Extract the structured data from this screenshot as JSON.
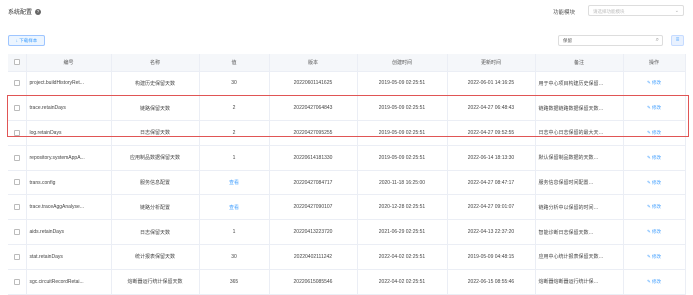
{
  "header": {
    "title": "系统配置",
    "help_icon": "?",
    "module_label": "功能模块",
    "module_placeholder": "请选择功能模块"
  },
  "toolbar": {
    "download_label": "↓ 下载样本",
    "search_value": "保留",
    "columns_icon": "≡"
  },
  "table": {
    "columns": [
      "",
      "编号",
      "名称",
      "值",
      "版本",
      "创建时间",
      "更新时间",
      "备注",
      "操作"
    ],
    "rows": [
      {
        "code": "project.buildHistoryRet...",
        "name": "构建历史保留天数",
        "value": "30",
        "version": "20220601141625",
        "created": "2019-05-09 02:25:51",
        "updated": "2022-06-01 14:16:25",
        "remark": "用于中心项目构建历史保留…",
        "action": "✎ 修改"
      },
      {
        "code": "trace.retainDays",
        "name": "链路保留天数",
        "value": "2",
        "version": "20220427064843",
        "created": "2019-05-09 02:25:51",
        "updated": "2022-04-27 06:48:43",
        "remark": "链路数据链路数据保留天数…",
        "action": "✎ 修改"
      },
      {
        "code": "log.retainDays",
        "name": "日志保留天数",
        "value": "2",
        "version": "20220427095255",
        "created": "2019-05-09 02:25:51",
        "updated": "2022-04-27 09:52:55",
        "remark": "日志中心日志保留的最大天…",
        "action": "✎ 修改"
      },
      {
        "code": "repository.systemAppA...",
        "name": "应用制品数据保留天数",
        "value": "1",
        "version": "20220614181330",
        "created": "2019-05-09 02:25:51",
        "updated": "2022-06-14 18:13:30",
        "remark": "默认保留制品数据的天数…",
        "action": "✎ 修改"
      },
      {
        "code": "trans.config",
        "name": "服务信息配置",
        "value": "查看",
        "version": "20220427084717",
        "created": "2020-11-18 16:25:00",
        "updated": "2022-04-27 08:47:17",
        "remark": "服务信息保留时间配置…",
        "action": "✎ 修改"
      },
      {
        "code": "trace.traceAggAnalyse...",
        "name": "链路分析配置",
        "value": "查看",
        "version": "20220427090107",
        "created": "2020-12-28 02:25:51",
        "updated": "2022-04-27 09:01:07",
        "remark": "链路分析中以保留的时间…",
        "action": "✎ 修改"
      },
      {
        "code": "aids.retainDays",
        "name": "日志保留天数",
        "value": "1",
        "version": "20220413223720",
        "created": "2021-06-29 02:25:51",
        "updated": "2022-04-13 22:37:20",
        "remark": "智能诊断日志保留天数…",
        "action": "✎ 修改"
      },
      {
        "code": "stat.retainDays",
        "name": "统计报表保留天数",
        "value": "30",
        "version": "20220402111242",
        "created": "2022-04-02 02:25:51",
        "updated": "2019-05-09 04:48:15",
        "remark": "应用中心统计报表保留天数…",
        "action": "✎ 修改"
      },
      {
        "code": "sgc.circuitRecordRetai...",
        "name": "熔断器运行统计保留天数",
        "value": "365",
        "version": "20220615085546",
        "created": "2022-04-02 02:25:51",
        "updated": "2022-06-15 08:55:46",
        "remark": "熔断器熔断器运行统计保…",
        "action": "✎ 修改"
      }
    ]
  },
  "colors": {
    "accent": "#409eff",
    "highlight": "#e05555"
  }
}
